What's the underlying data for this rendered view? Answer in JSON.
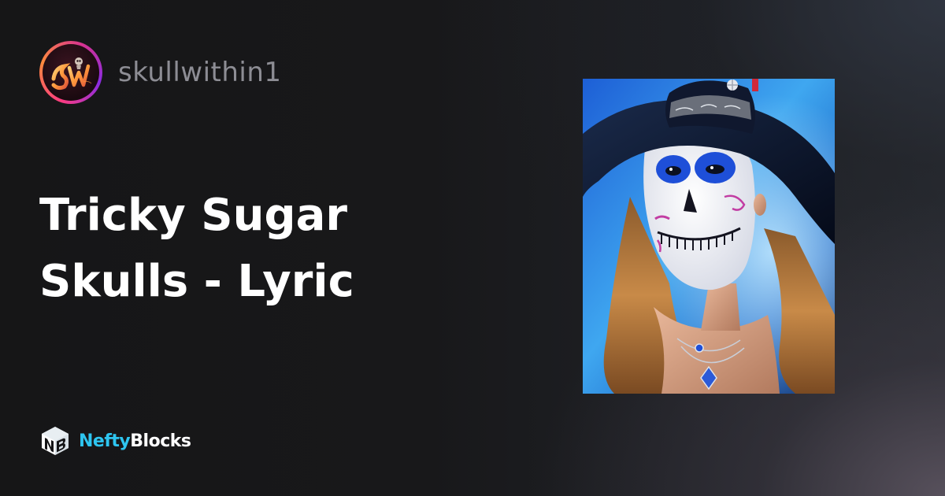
{
  "creator": {
    "username": "skullwithin1",
    "avatar_icon": "skullwithin-avatar-icon",
    "avatar_monogram": "SW"
  },
  "collection": {
    "title_line_1": "Tricky Sugar",
    "title_line_2": "Skulls - Lyric"
  },
  "brand": {
    "name_part_1": "Nefty",
    "name_part_2": "Blocks",
    "logo_icon": "neftyblocks-cube-icon",
    "logo_monogram": "NB",
    "accent_color": "#2ec5f0"
  },
  "artwork": {
    "image_icon": "sugar-skull-portrait-image"
  }
}
